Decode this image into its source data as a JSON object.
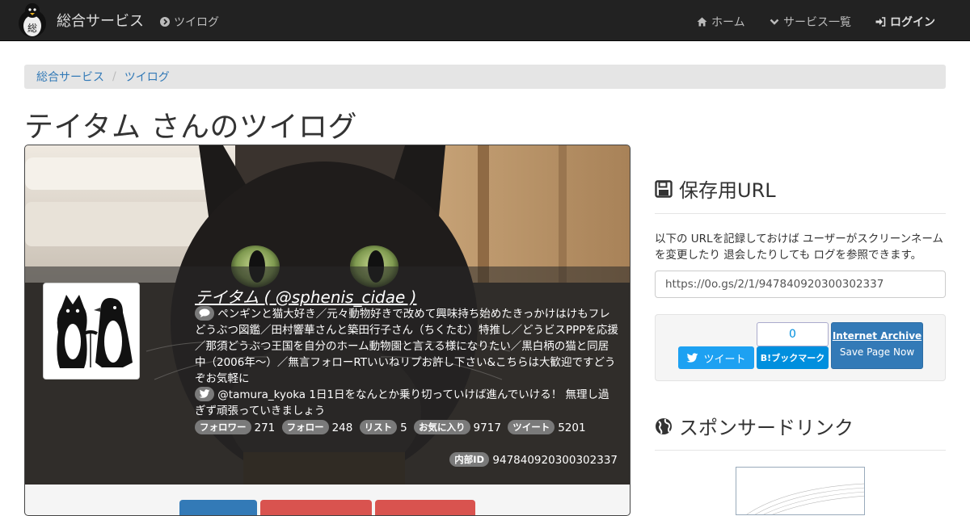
{
  "navbar": {
    "brand": "総合サービス",
    "brand_logo_char": "総",
    "twilog_link": "ツイログ",
    "home_link": "ホーム",
    "services_link": "サービス一覧",
    "login_link": "ログイン"
  },
  "breadcrumb": [
    "総合サービス",
    "ツイログ"
  ],
  "page_title": "テイタム さんのツイログ",
  "profile": {
    "display_name": "テイタム ( @sphenis_cidae )",
    "bio": "ペンギンと猫大好き／元々動物好きで改めて興味持ち始めたきっかけはけもフレどうぶつ図鑑／田村響華さんと築田行子さん（ちくたむ）特推し／どうビスPPPを応援／那須どうぶつ王国を自分のホーム動物園と言える様になりたい／黒白柄の猫と同居中（2006年～）／無言フォローRTいいねリプお許し下さい&こちらは大歓迎ですどうぞお気軽に",
    "latest_tweet": "@tamura_kyoka 1日1日をなんとか乗り切っていけば進んでいける！ 無理し過ぎず頑張っていきましょう",
    "stats": [
      {
        "label": "フォロワー",
        "value": "271"
      },
      {
        "label": "フォロー",
        "value": "248"
      },
      {
        "label": "リスト",
        "value": "5"
      },
      {
        "label": "お気に入り",
        "value": "9717"
      },
      {
        "label": "ツイート",
        "value": "5201"
      }
    ],
    "internal_id_label": "内部ID",
    "internal_id": "947840920300302337"
  },
  "sidebar": {
    "save_url_heading": "保存用URL",
    "description": "以下の URLを記録しておけば ユーザーがスクリーンネームを変更したり 退会したりしても ログを参照できます。",
    "saved_url": "https://0o.gs/2/1/947840920300302337",
    "tweet_button": "ツイート",
    "hatena_count": "0",
    "hatena_button": "B!ブックマーク",
    "ia_title": "Internet Archive",
    "ia_sub": "Save Page Now",
    "sponsor_heading": "スポンサードリンク"
  },
  "colors": {
    "navbar": "#222222",
    "link": "#337ab7",
    "twitter": "#1da1f2",
    "hatena": "#008fde",
    "danger": "#d9534f"
  }
}
